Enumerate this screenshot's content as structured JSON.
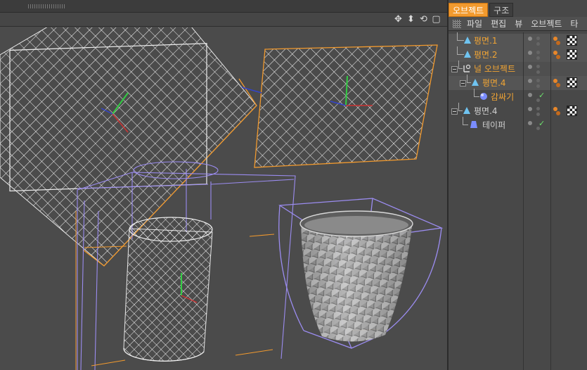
{
  "panel": {
    "tabs": [
      {
        "label": "오브젝트",
        "active": true
      },
      {
        "label": "구조",
        "active": false
      }
    ],
    "menu": [
      "파일",
      "편집",
      "뷰",
      "오브젝트",
      "타"
    ],
    "objects": [
      {
        "name": "평면.1",
        "icon": "plane-icon",
        "color": "orange"
      },
      {
        "name": "평면.2",
        "icon": "plane-icon",
        "color": "orange"
      },
      {
        "name": "널 오브젝트",
        "icon": "null-object-icon",
        "color": "orange"
      },
      {
        "name": "평면.4",
        "icon": "plane-icon",
        "color": "orange"
      },
      {
        "name": "감싸기",
        "icon": "wrap-deformer-icon",
        "color": "orange"
      },
      {
        "name": "평면.4",
        "icon": "plane-icon",
        "color": "grey"
      },
      {
        "name": "테이퍼",
        "icon": "taper-deformer-icon",
        "color": "grey"
      }
    ]
  },
  "viewport": {
    "nav_icons": [
      "move-view-icon",
      "zoom-view-icon",
      "rotate-view-icon",
      "maximize-view-icon"
    ],
    "selection_color": "#f29a2e",
    "deformer_color": "#9b8cf0"
  }
}
